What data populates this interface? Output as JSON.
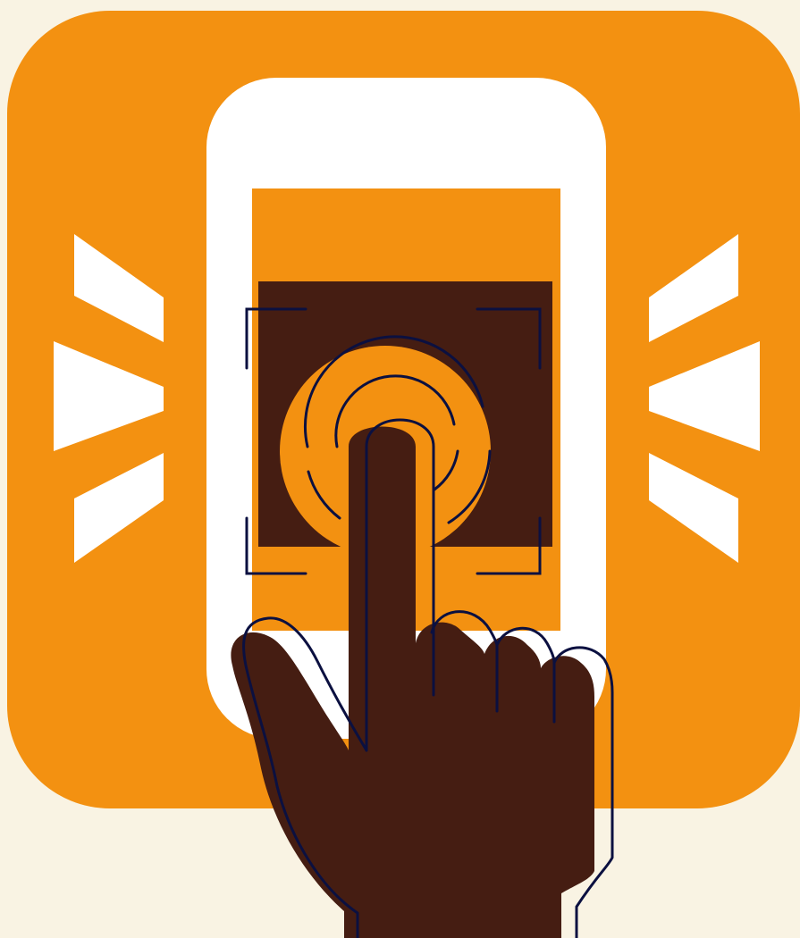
{
  "illustration": {
    "subject": "hand-tapping-phone-screen",
    "colors": {
      "background": "#f9f3e3",
      "panel": "#f39111",
      "phone_body": "#ffffff",
      "phone_screen": "#f39111",
      "touch_square": "#451d12",
      "hand": "#451d12",
      "outline": "#0b1040",
      "rays": "#ffffff"
    },
    "icons": [
      "smartphone-icon",
      "tap-gesture-icon",
      "pointing-hand-icon",
      "scan-frame-icon",
      "vibration-rays-icon"
    ]
  }
}
